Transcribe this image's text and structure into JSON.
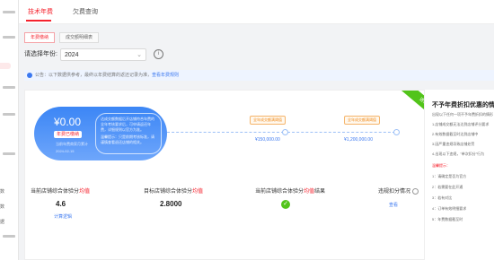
{
  "top_tabs": [
    "技术年费",
    "欠费查询"
  ],
  "sub_tabs": [
    "年费缴纳",
    "成交额明细表"
  ],
  "year": {
    "label": "请选择年份:",
    "value": "2024"
  },
  "notice": {
    "prefix": "公告：以下数据供参考，最终以年费结算的返还记录为准，",
    "link": "查看年费规则"
  },
  "ribbon": "进行中",
  "fee": {
    "amount": "¥0.00",
    "badge": "年费已缴纳",
    "line1": "当前年费商家月累计",
    "line2": "2024-02-15",
    "desc": "达成交额数据后开店铺符合年费的全年考核要求后，可申请返还年费，详细规则以官方为准。",
    "warn": "温馨提示：只是前期考核标准，请谨慎查看退还店铺的相关。"
  },
  "tiers": [
    {
      "label": "全年成交额满阈值",
      "value": "¥150,000.00"
    },
    {
      "label": "全年成交额满阈值",
      "value": "¥1,200,000.00"
    }
  ],
  "metrics": [
    {
      "label_pre": "当前店铺综合体验分",
      "label_red": "均值",
      "value": "4.6",
      "link": "计算逻辑"
    },
    {
      "label_pre": "目标店铺综合体验分",
      "label_red": "均值",
      "value": "2.8000"
    },
    {
      "label_pre": "当前店铺综合体验分",
      "label_red": "均值",
      "label_post": "结果"
    },
    {
      "label": "违规扣分情况",
      "link": "查看"
    }
  ],
  "right_panel": {
    "title": "不予年费折扣优惠的情形",
    "lines": [
      "出现以下任何一项不予年费折扣的情形",
      "1.店铺成交额无法达到店铺评分要求",
      "2.有效数据截至时达到店铺中",
      "3.因严重违规导致店铺处罚",
      "4.出现以下违规，\"单次扣分\"行为"
    ],
    "heading": "温馨提示：",
    "more": [
      "1：请确定是否为官方",
      "2：若需要在此开通",
      "3：若有对比",
      "4：订单有效明细要求",
      "5：年费数据截至时"
    ]
  },
  "sidebar": {
    "labels": [
      "数",
      "数",
      "据"
    ]
  }
}
